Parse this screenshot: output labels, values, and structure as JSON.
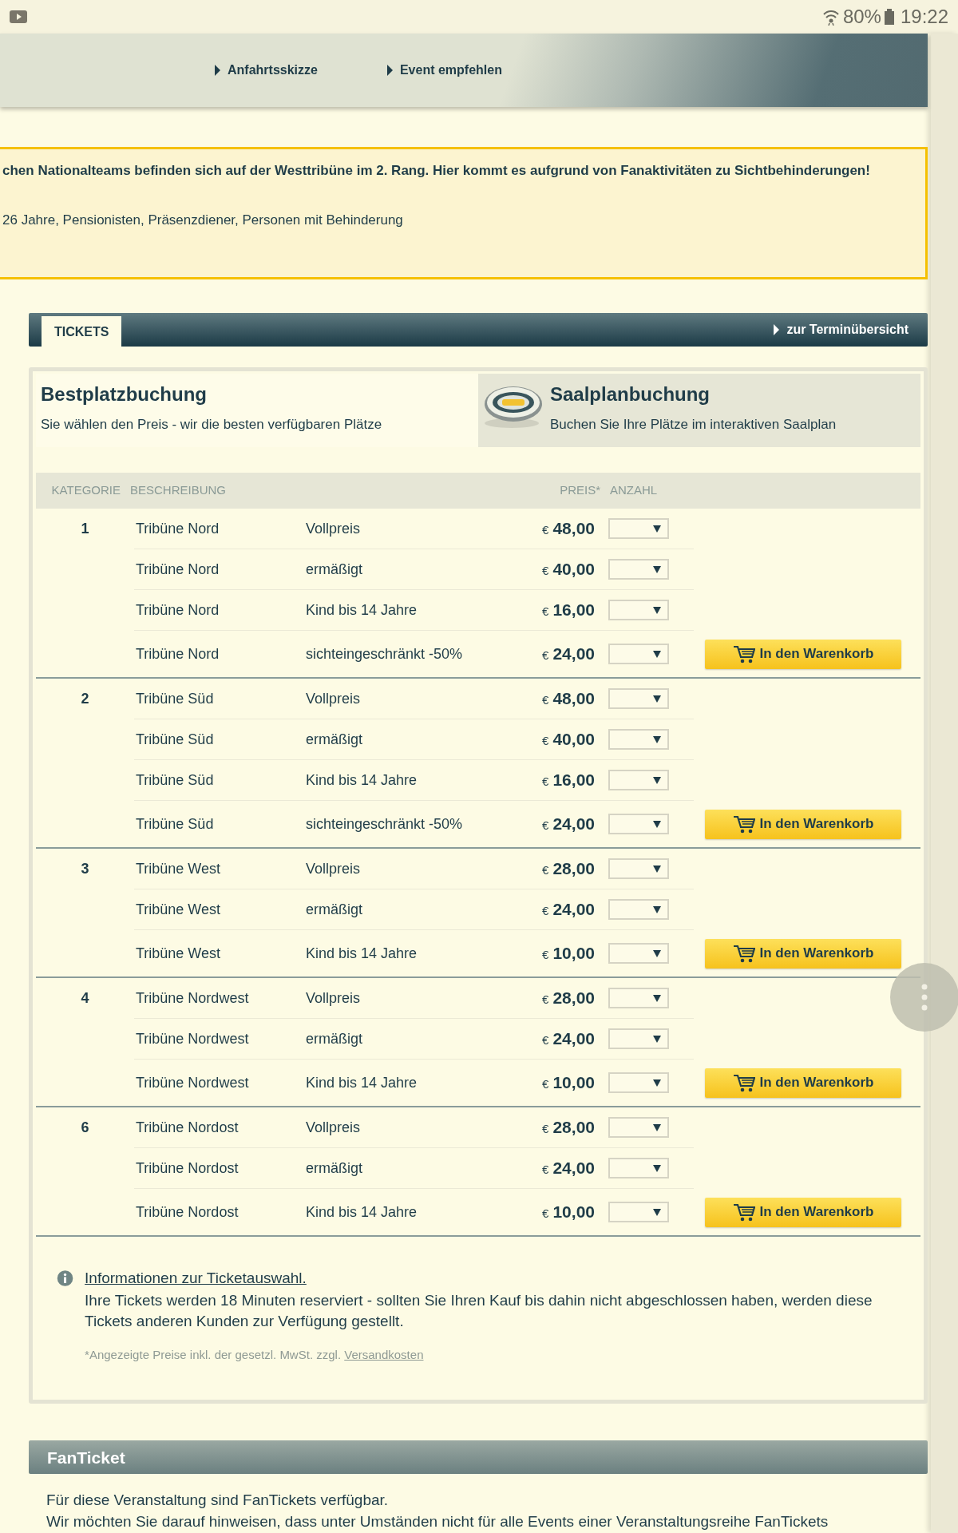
{
  "status_bar": {
    "battery": "80%",
    "time": "19:22"
  },
  "header_links": [
    {
      "label": "Anfahrtsskizze"
    },
    {
      "label": "Event empfehlen"
    }
  ],
  "notice": {
    "lines": [
      {
        "text": "chen Nationalteams befinden sich auf der Westtribüne im 2. Rang. Hier kommt es aufgrund von Fanaktivitäten zu Sichtbehinderungen!",
        "bold": true
      },
      {
        "text": "26 Jahre, Pensionisten, Präsenzdiener, Personen mit Behinderung",
        "bold": false
      }
    ]
  },
  "tickets_bar": {
    "tab": "TICKETS",
    "link": "zur Terminübersicht"
  },
  "booking_tabs": [
    {
      "title": "Bestplatzbuchung",
      "subtitle": "Sie wählen den Preis - wir die besten verfügbaren Plätze",
      "selected": true
    },
    {
      "title": "Saalplanbuchung",
      "subtitle": "Buchen Sie Ihre Plätze im interaktiven Saalplan",
      "selected": false
    }
  ],
  "table": {
    "columns": [
      "KATEGORIE",
      "BESCHREIBUNG",
      "PREIS*",
      "ANZAHL"
    ],
    "categories": [
      {
        "number": "1",
        "button": "In den Warenkorb",
        "rows": [
          {
            "area": "Tribüne Nord",
            "description": "Vollpreis",
            "currency": "€",
            "price": "48,00"
          },
          {
            "area": "Tribüne Nord",
            "description": "ermäßigt",
            "currency": "€",
            "price": "40,00"
          },
          {
            "area": "Tribüne Nord",
            "description": "Kind bis 14 Jahre",
            "currency": "€",
            "price": "16,00"
          },
          {
            "area": "Tribüne Nord",
            "description": "sichteingeschränkt -50%",
            "currency": "€",
            "price": "24,00"
          }
        ]
      },
      {
        "number": "2",
        "button": "In den Warenkorb",
        "rows": [
          {
            "area": "Tribüne Süd",
            "description": "Vollpreis",
            "currency": "€",
            "price": "48,00"
          },
          {
            "area": "Tribüne Süd",
            "description": "ermäßigt",
            "currency": "€",
            "price": "40,00"
          },
          {
            "area": "Tribüne Süd",
            "description": "Kind bis 14 Jahre",
            "currency": "€",
            "price": "16,00"
          },
          {
            "area": "Tribüne Süd",
            "description": "sichteingeschränkt -50%",
            "currency": "€",
            "price": "24,00"
          }
        ]
      },
      {
        "number": "3",
        "button": "In den Warenkorb",
        "rows": [
          {
            "area": "Tribüne West",
            "description": "Vollpreis",
            "currency": "€",
            "price": "28,00"
          },
          {
            "area": "Tribüne West",
            "description": "ermäßigt",
            "currency": "€",
            "price": "24,00"
          },
          {
            "area": "Tribüne West",
            "description": "Kind bis 14 Jahre",
            "currency": "€",
            "price": "10,00"
          }
        ]
      },
      {
        "number": "4",
        "button": "In den Warenkorb",
        "rows": [
          {
            "area": "Tribüne Nordwest",
            "description": "Vollpreis",
            "currency": "€",
            "price": "28,00"
          },
          {
            "area": "Tribüne Nordwest",
            "description": "ermäßigt",
            "currency": "€",
            "price": "24,00"
          },
          {
            "area": "Tribüne Nordwest",
            "description": "Kind bis 14 Jahre",
            "currency": "€",
            "price": "10,00"
          }
        ]
      },
      {
        "number": "6",
        "button": "In den Warenkorb",
        "rows": [
          {
            "area": "Tribüne Nordost",
            "description": "Vollpreis",
            "currency": "€",
            "price": "28,00"
          },
          {
            "area": "Tribüne Nordost",
            "description": "ermäßigt",
            "currency": "€",
            "price": "24,00"
          },
          {
            "area": "Tribüne Nordost",
            "description": "Kind bis 14 Jahre",
            "currency": "€",
            "price": "10,00"
          }
        ]
      }
    ]
  },
  "info": {
    "link": "Informationen zur Ticketauswahl.",
    "text": "Ihre Tickets werden 18 Minuten reserviert - sollten Sie Ihren Kauf bis dahin nicht abgeschlossen haben, werden diese Tickets anderen Kunden zur Verfügung gestellt.",
    "footnote": "*Angezeigte Preise inkl. der gesetzl. MwSt. zzgl.",
    "footnote_link": "Versandkosten"
  },
  "fanticket": {
    "title": "FanTicket",
    "lines": [
      "Für diese Veranstaltung sind FanTickets verfügbar.",
      "Wir möchten Sie darauf hinweisen, dass unter Umständen nicht für alle Events einer Veranstaltungsreihe FanTickets"
    ]
  }
}
